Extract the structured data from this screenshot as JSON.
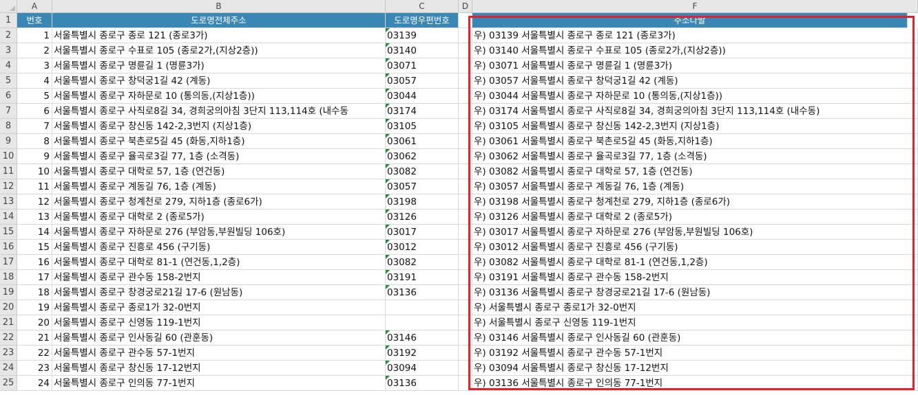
{
  "columns": [
    "A",
    "B",
    "C",
    "D",
    "F"
  ],
  "header_row": {
    "row_number": "1",
    "a": "번호",
    "b": "도로명전체주소",
    "c": "도로명우편번호",
    "d": "",
    "f": "주소다발"
  },
  "rows": [
    {
      "n": "2",
      "a": "1",
      "b": "서울특별시 종로구 종로 121 (종로3가)",
      "c": "03139",
      "f": "우) 03139  서울특별시 종로구 종로 121 (종로3가)"
    },
    {
      "n": "3",
      "a": "2",
      "b": "서울특별시 종로구 수표로 105 (종로2가,(지상2층))",
      "c": "03140",
      "f": "우) 03140  서울특별시 종로구 수표로 105 (종로2가,(지상2층))"
    },
    {
      "n": "4",
      "a": "3",
      "b": "서울특별시 종로구 명륜길 1 (명륜3가)",
      "c": "03071",
      "f": "우) 03071  서울특별시 종로구 명륜길 1 (명륜3가)"
    },
    {
      "n": "5",
      "a": "4",
      "b": "서울특별시 종로구 창덕궁1길 42 (계동)",
      "c": "03057",
      "f": "우) 03057  서울특별시 종로구 창덕궁1길 42 (계동)"
    },
    {
      "n": "6",
      "a": "5",
      "b": "서울특별시 종로구 자하문로 10 (통의동,(지상1층))",
      "c": "03044",
      "f": "우) 03044  서울특별시 종로구 자하문로 10 (통의동,(지상1층))"
    },
    {
      "n": "7",
      "a": "6",
      "b": "서울특별시 종로구 사직로8길 34, 경희궁의아침 3단지 113,114호 (내수동",
      "c": "03174",
      "f": "우) 03174  서울특별시 종로구 사직로8길 34, 경희궁의아침 3단지 113,114호 (내수동)"
    },
    {
      "n": "8",
      "a": "7",
      "b": "서울특별시 종로구 창신동 142-2,3번지 (지상1층)",
      "c": "03105",
      "f": "우) 03105  서울특별시 종로구 창신동 142-2,3번지 (지상1층)"
    },
    {
      "n": "9",
      "a": "8",
      "b": "서울특별시 종로구 북촌로5길 45 (화동,지하1층)",
      "c": "03061",
      "f": "우) 03061  서울특별시 종로구 북촌로5길 45 (화동,지하1층)"
    },
    {
      "n": "10",
      "a": "9",
      "b": "서울특별시 종로구 율곡로3길 77, 1층 (소격동)",
      "c": "03062",
      "f": "우) 03062  서울특별시 종로구 율곡로3길 77, 1층 (소격동)"
    },
    {
      "n": "11",
      "a": "10",
      "b": "서울특별시 종로구 대학로 57, 1층 (연건동)",
      "c": "03082",
      "f": "우) 03082  서울특별시 종로구 대학로 57, 1층 (연건동)"
    },
    {
      "n": "12",
      "a": "11",
      "b": "서울특별시 종로구 계동길 76, 1층 (계동)",
      "c": "03057",
      "f": "우) 03057  서울특별시 종로구 계동길 76, 1층 (계동)"
    },
    {
      "n": "13",
      "a": "12",
      "b": "서울특별시 종로구 청계천로 279, 지하1층 (종로6가)",
      "c": "03198",
      "f": "우) 03198  서울특별시 종로구 청계천로 279, 지하1층 (종로6가)"
    },
    {
      "n": "14",
      "a": "13",
      "b": "서울특별시 종로구 대학로 2 (종로5가)",
      "c": "03126",
      "f": "우) 03126  서울특별시 종로구 대학로 2 (종로5가)"
    },
    {
      "n": "15",
      "a": "14",
      "b": "서울특별시 종로구 자하문로 276 (부암동,부원빌딩 106호)",
      "c": "03017",
      "f": "우) 03017  서울특별시 종로구 자하문로 276 (부암동,부원빌딩 106호)"
    },
    {
      "n": "16",
      "a": "15",
      "b": "서울특별시 종로구 진흥로 456 (구기동)",
      "c": "03012",
      "f": "우) 03012  서울특별시 종로구 진흥로 456 (구기동)"
    },
    {
      "n": "17",
      "a": "16",
      "b": "서울특별시 종로구 대학로 81-1 (연건동,1,2층)",
      "c": "03082",
      "f": "우) 03082  서울특별시 종로구 대학로 81-1 (연건동,1,2층)"
    },
    {
      "n": "18",
      "a": "17",
      "b": "서울특별시 종로구 관수동 158-2번지",
      "c": "03191",
      "f": "우) 03191  서울특별시 종로구 관수동 158-2번지"
    },
    {
      "n": "19",
      "a": "18",
      "b": "서울특별시 종로구 창경궁로21길 17-6 (원남동)",
      "c": "03136",
      "f": "우) 03136  서울특별시 종로구 창경궁로21길 17-6 (원남동)"
    },
    {
      "n": "20",
      "a": "19",
      "b": "서울특별시 종로구 종로1가 32-0번지",
      "c": "",
      "f": "우)    서울특별시 종로구 종로1가 32-0번지"
    },
    {
      "n": "21",
      "a": "20",
      "b": "서울특별시 종로구 신영동 119-1번지",
      "c": "",
      "f": "우)    서울특별시 종로구 신영동 119-1번지"
    },
    {
      "n": "22",
      "a": "21",
      "b": "서울특별시 종로구 인사동길 60 (관훈동)",
      "c": "03146",
      "f": "우) 03146  서울특별시 종로구 인사동길 60 (관훈동)"
    },
    {
      "n": "23",
      "a": "22",
      "b": "서울특별시 종로구 관수동 57-1번지",
      "c": "03192",
      "f": "우) 03192  서울특별시 종로구 관수동 57-1번지"
    },
    {
      "n": "24",
      "a": "23",
      "b": "서울특별시 종로구 창신동 17-12번지",
      "c": "03094",
      "f": "우) 03094  서울특별시 종로구 창신동 17-12번지"
    },
    {
      "n": "25",
      "a": "24",
      "b": "서울특별시 종로구 인의동 77-1번지",
      "c": "03136",
      "f": "우) 03136  서울특별시 종로구 인의동 77-1번지"
    }
  ],
  "colors": {
    "header_fill": "#3a86b4",
    "selection_border": "#e3202b",
    "error_flag": "#1f8a3a"
  }
}
